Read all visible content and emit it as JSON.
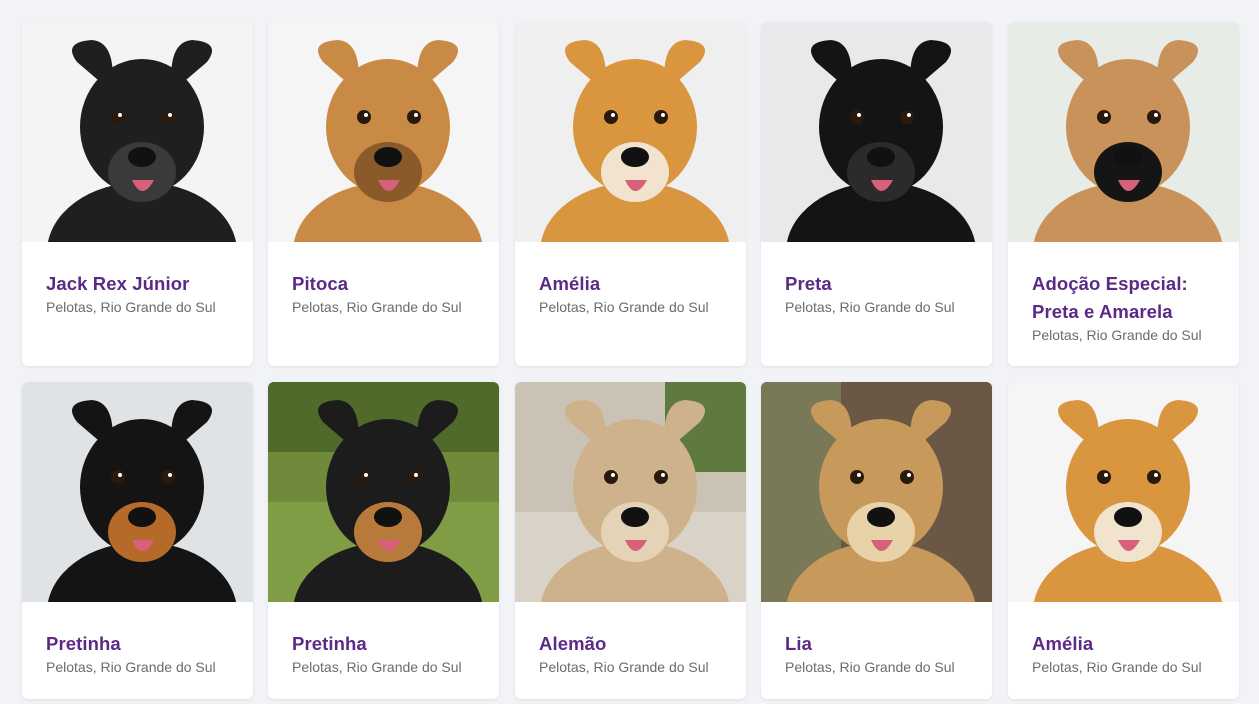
{
  "grid": {
    "pets": [
      {
        "name": "Jack Rex Júnior",
        "location": "Pelotas, Rio Grande do Sul",
        "photo": "black-dog-smiling",
        "bg": "#f4f4f4",
        "fur": "#1f1f1f",
        "fur2": "#3a3a3a"
      },
      {
        "name": "Pitoca",
        "location": "Pelotas, Rio Grande do Sul",
        "photo": "tan-dog-collar",
        "bg": "#f5f5f5",
        "fur": "#c98a45",
        "fur2": "#8a5a2b"
      },
      {
        "name": "Amélia",
        "location": "Pelotas, Rio Grande do Sul",
        "photo": "golden-dog-bows",
        "bg": "#efefef",
        "fur": "#d9963f",
        "fur2": "#f2e3cf"
      },
      {
        "name": "Preta",
        "location": "Pelotas, Rio Grande do Sul",
        "photo": "black-dog-bowtie",
        "bg": "#e9e9eb",
        "fur": "#141414",
        "fur2": "#2b2b2b"
      },
      {
        "name": "Adoção Especial: Preta e Amarela",
        "location": "Pelotas, Rio Grande do Sul",
        "photo": "two-dogs-kissing",
        "bg": "#e7ece6",
        "fur": "#c9925a",
        "fur2": "#151515"
      },
      {
        "name": "Pretinha",
        "location": "Pelotas, Rio Grande do Sul",
        "photo": "black-tan-dog-portrait",
        "bg": "#dfe3e6",
        "fur": "#141414",
        "fur2": "#b56a2a"
      },
      {
        "name": "Pretinha",
        "location": "Pelotas, Rio Grande do Sul",
        "photo": "black-tan-dog-grass",
        "bg": "#6e8a3a",
        "fur": "#1c1c1c",
        "fur2": "#b87a3a"
      },
      {
        "name": "Alemão",
        "location": "Pelotas, Rio Grande do Sul",
        "photo": "fluffy-cream-dog",
        "bg": "#c9c2b5",
        "fur": "#cdb28c",
        "fur2": "#e4d3b6"
      },
      {
        "name": "Lia",
        "location": "Pelotas, Rio Grande do Sul",
        "photo": "fluffy-golden-dog-smiling",
        "bg": "#7d6a55",
        "fur": "#c79a5c",
        "fur2": "#e8d2a8"
      },
      {
        "name": "Amélia",
        "location": "Pelotas, Rio Grande do Sul",
        "photo": "golden-dog-bows",
        "bg": "#f5f5f5",
        "fur": "#d9963f",
        "fur2": "#f2e3cf"
      }
    ]
  },
  "colors": {
    "page_bg": "#f2f3f6",
    "name": "#5b2a86",
    "location": "#6b6b6b"
  }
}
